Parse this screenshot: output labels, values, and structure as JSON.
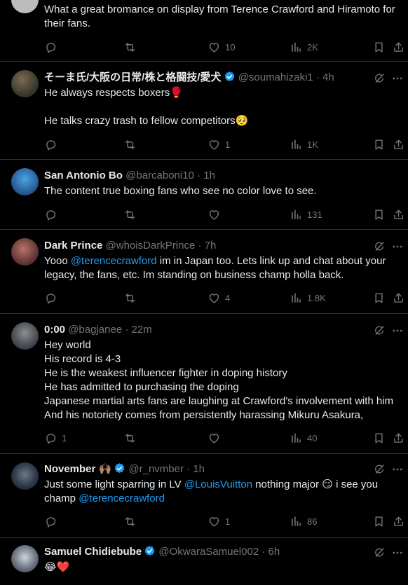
{
  "posts": [
    {
      "text_lines": [
        "What a great bromance on display from Terence Crawford and Hiramoto for",
        "their fans."
      ],
      "stats": {
        "reply": "",
        "repost": "",
        "like": "10",
        "views": "2K"
      }
    },
    {
      "name": "そーま氏/大阪の日常/株と格闘技/愛犬",
      "handle": "@soumahizaki1",
      "time": "· 4h",
      "text_lines": [
        "He always respects boxers🥊",
        "",
        "He talks crazy trash to fellow competitors🥺"
      ],
      "stats": {
        "reply": "",
        "repost": "",
        "like": "1",
        "views": "1K"
      }
    },
    {
      "name": "San Antonio Bo",
      "handle": "@barcaboni10",
      "time": "· 1h",
      "text_lines": [
        "The content true boxing fans who see no color love to see."
      ],
      "stats": {
        "reply": "",
        "repost": "",
        "like": "",
        "views": "131"
      }
    },
    {
      "name": "Dark Prince",
      "handle": "@whoisDarkPrince",
      "time": "· 7h",
      "text_line1_pre": "Yooo ",
      "text_line1_mention": "@terencecrawford",
      "text_line1_post": " im in Japan too. Lets link up and chat about your",
      "text_line2": "legacy, the fans, etc. Im standing on business champ holla back.",
      "stats": {
        "reply": "",
        "repost": "",
        "like": "4",
        "views": "1.8K"
      }
    },
    {
      "name": "0:00",
      "handle": "@bagjanee",
      "time": "· 22m",
      "text_lines": [
        "Hey world",
        "His record is 4-3",
        "He is the weakest influencer fighter in doping history",
        "He has admitted to purchasing the doping",
        "Japanese martial arts fans are laughing at Crawford's involvement with him",
        "And his notoriety comes from persistently harassing Mikuru Asakura,"
      ],
      "stats": {
        "reply": "1",
        "repost": "",
        "like": "",
        "views": "40"
      }
    },
    {
      "name": "November",
      "name_emoji": "🙌🏽",
      "handle": "@r_nvmber",
      "time": "· 1h",
      "text_line1_pre": "Just some light sparring in LV ",
      "text_line1_mention": "@LouisVuitton",
      "text_line1_post": "  nothing major 😏 i see you",
      "text_line2_pre": "champ ",
      "text_line2_mention": "@terencecrawford",
      "stats": {
        "reply": "",
        "repost": "",
        "like": "1",
        "views": "86"
      }
    },
    {
      "name": "Samuel Chidiebube",
      "handle": "@OkwaraSamuel002",
      "time": "· 6h",
      "text_lines": [
        "😂❤️"
      ]
    }
  ],
  "icons": [
    "reply-icon",
    "repost-icon",
    "like-icon",
    "views-icon",
    "bookmark-icon",
    "share-icon",
    "grok-icon",
    "more-icon",
    "verified-icon"
  ],
  "colors": {
    "background": "#000000",
    "text": "#e7e9ea",
    "secondary": "#71767b",
    "accent": "#1d9bf0",
    "divider": "#2f3336"
  }
}
